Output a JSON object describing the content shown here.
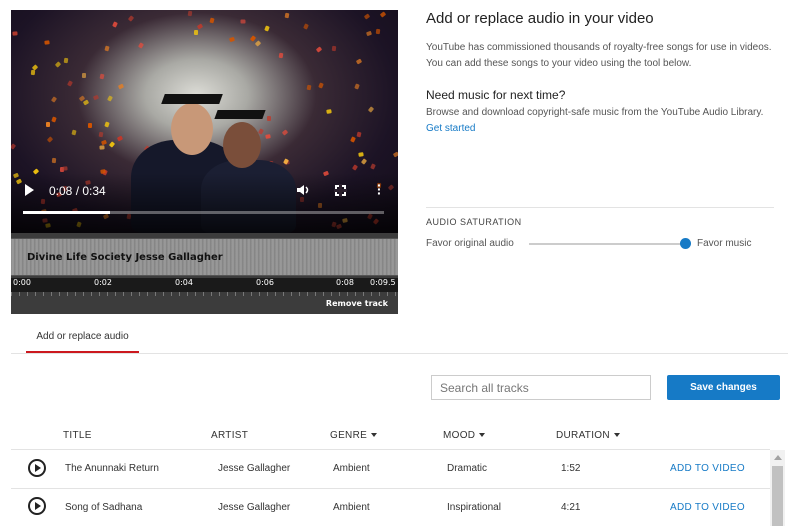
{
  "player": {
    "time": "0:08 / 0:34",
    "progress_fraction": 0.24
  },
  "track": {
    "name": "Divine Life Society Jesse Gallagher",
    "ticks": [
      "0:00",
      "0:02",
      "0:04",
      "0:06",
      "0:08",
      "0:09.5"
    ],
    "remove_label": "Remove track"
  },
  "panel": {
    "title": "Add or replace audio in your video",
    "intro": "YouTube has commissioned thousands of royalty-free songs for use in videos. You can add these songs to your video using the tool below.",
    "need_music_title": "Need music for next time?",
    "need_music_text": "Browse and download copyright-safe music from the YouTube Audio Library.",
    "get_started": "Get started",
    "saturation_label": "AUDIO SATURATION",
    "favor_original": "Favor original audio",
    "favor_music": "Favor music",
    "saturation_fraction": 1.0
  },
  "tabs": {
    "active": "Add or replace audio"
  },
  "search": {
    "placeholder": "Search all tracks"
  },
  "save_label": "Save changes",
  "table": {
    "headers": {
      "title": "TITLE",
      "artist": "ARTIST",
      "genre": "GENRE",
      "mood": "MOOD",
      "duration": "DURATION"
    },
    "rows": [
      {
        "title": "The Anunnaki Return",
        "artist": "Jesse Gallagher",
        "genre": "Ambient",
        "mood": "Dramatic",
        "duration": "1:52",
        "action": "ADD TO VIDEO"
      },
      {
        "title": "Song of Sadhana",
        "artist": "Jesse Gallagher",
        "genre": "Ambient",
        "mood": "Inspirational",
        "duration": "4:21",
        "action": "ADD TO VIDEO"
      }
    ]
  },
  "colors": {
    "accent": "#167ac6",
    "tab_underline": "#cc181e"
  }
}
